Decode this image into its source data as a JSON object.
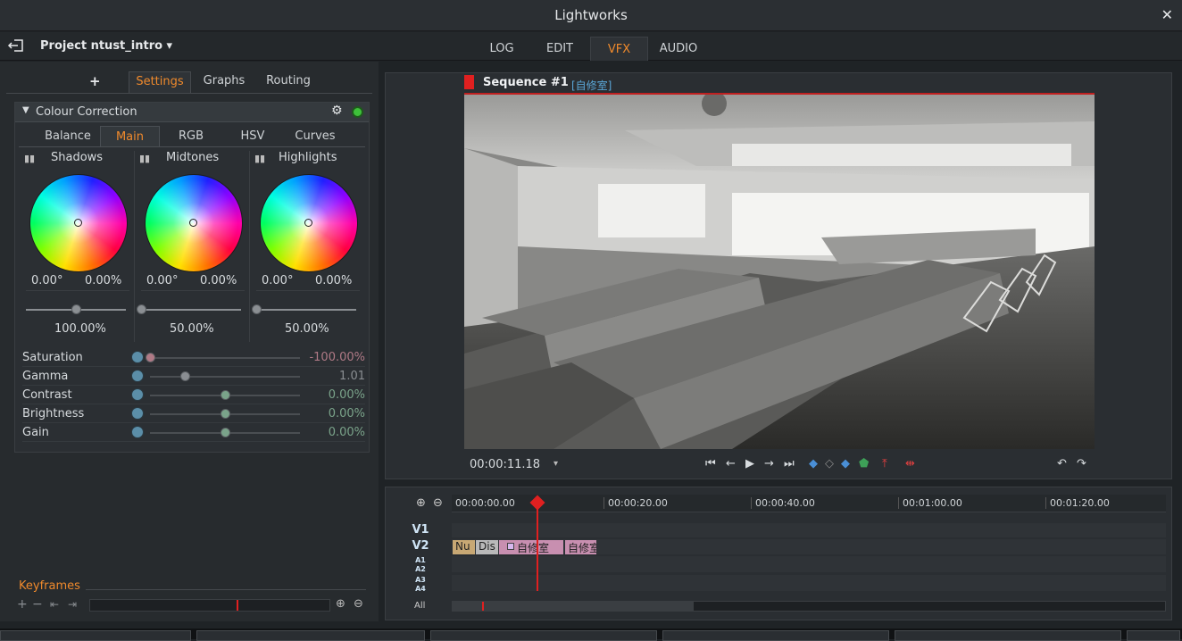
{
  "window": {
    "title": "Lightworks",
    "close_glyph": "✕"
  },
  "menubar": {
    "project_label": "Project ntust_intro ▾",
    "tabs": [
      "LOG",
      "EDIT",
      "VFX",
      "AUDIO"
    ],
    "active_tab": "VFX"
  },
  "effects_panel": {
    "add_glyph": "+",
    "tabs": [
      "Settings",
      "Graphs",
      "Routing"
    ],
    "active_tab": "Settings",
    "effect_title": "Colour Correction",
    "effect_tabs": [
      "Balance",
      "Main",
      "RGB",
      "HSV",
      "Curves"
    ],
    "active_effect_tab": "Main",
    "wheels": [
      {
        "label": "Shadows",
        "angle": "0.00°",
        "amount": "0.00%",
        "level": "100.00%",
        "level_fraction": 0.5
      },
      {
        "label": "Midtones",
        "angle": "0.00°",
        "amount": "0.00%",
        "level": "50.00%",
        "level_fraction": 0.0
      },
      {
        "label": "Highlights",
        "angle": "0.00°",
        "amount": "0.00%",
        "level": "50.00%",
        "level_fraction": 0.0
      }
    ],
    "params": [
      {
        "label": "Saturation",
        "value": "-100.00%",
        "fraction": 0.0,
        "color": "#b07a86"
      },
      {
        "label": "Gamma",
        "value": "1.01",
        "fraction": 0.23,
        "color": "#8a8e92"
      },
      {
        "label": "Contrast",
        "value": "0.00%",
        "fraction": 0.5,
        "color": "#7aa38a"
      },
      {
        "label": "Brightness",
        "value": "0.00%",
        "fraction": 0.5,
        "color": "#7aa38a"
      },
      {
        "label": "Gain",
        "value": "0.00%",
        "fraction": 0.5,
        "color": "#7aa38a"
      }
    ],
    "keyframes_label": "Keyframes"
  },
  "viewer": {
    "sequence_title": "Sequence #1",
    "sequence_tag": "[自修室]",
    "timecode": "00:00:11.18",
    "timecode_menu": "▾"
  },
  "timeline": {
    "ruler": [
      "00:00:00.00",
      "00:00:20.00",
      "00:00:40.00",
      "00:01:00.00",
      "00:01:20.00"
    ],
    "tracks": [
      "V1",
      "V2",
      "A1",
      "A2",
      "A3",
      "A4"
    ],
    "clips": [
      {
        "label": "Nu",
        "color": "#c8a874"
      },
      {
        "label": "Dis",
        "color": "#b9b9b9"
      },
      {
        "label": "自修室",
        "color": "#c88fb0"
      },
      {
        "label": "自修室",
        "color": "#c88fb0"
      }
    ],
    "all_label": "All"
  },
  "colors": {
    "accent": "#f08a2c",
    "playhead": "#e02020"
  }
}
